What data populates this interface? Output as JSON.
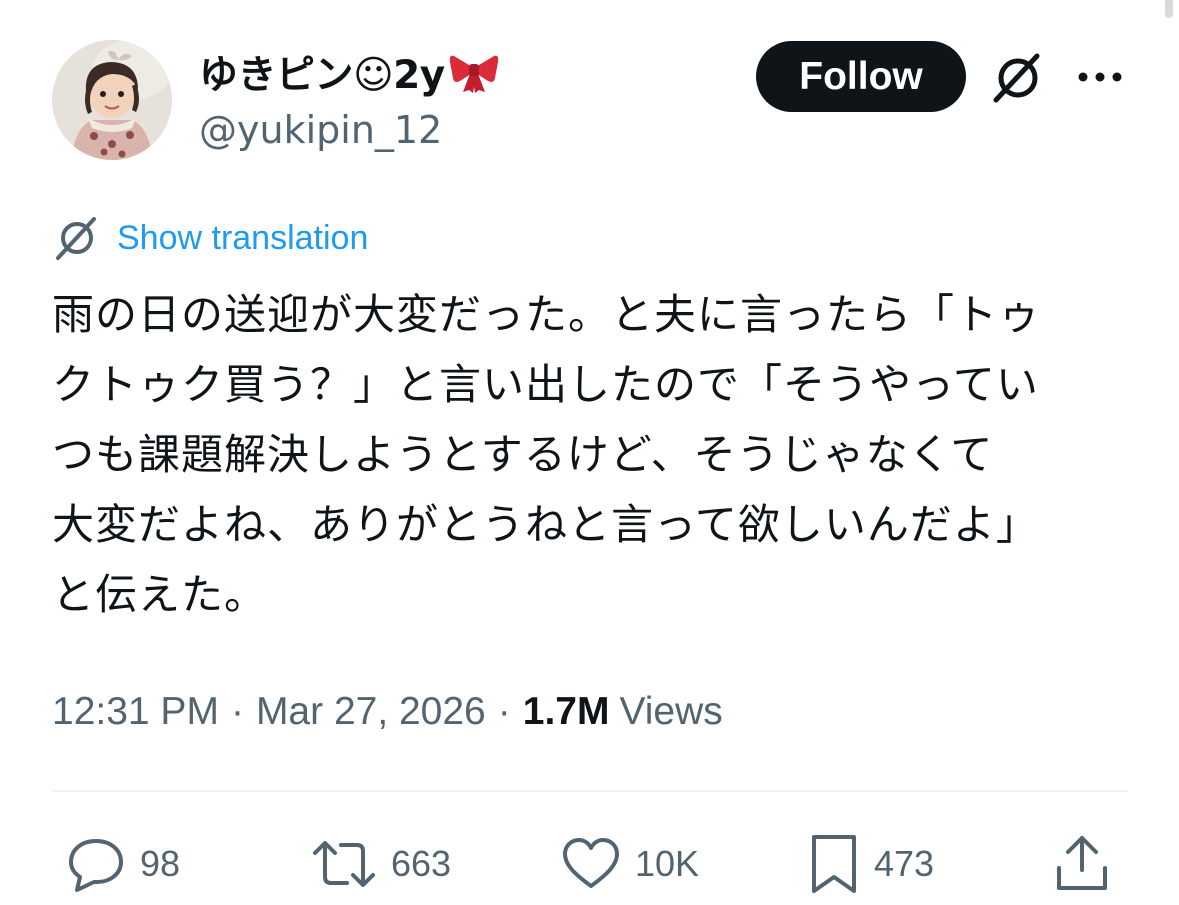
{
  "author": {
    "display_name": "ゆきピン☺2y",
    "handle": "@yukipin_12",
    "avatar_icon": "child-photo-avatar",
    "name_emoji_icon": "ribbon-bow-icon"
  },
  "header": {
    "follow_label": "Follow",
    "grok_icon": "grok-icon",
    "more_icon": "more-icon"
  },
  "translation": {
    "link_label": "Show translation",
    "link_color": "#1d9bf0"
  },
  "tweet": {
    "lines": [
      "雨の日の送迎が大変だった。と夫に言ったら「トゥ",
      "クトゥク買う？」と言い出したので「そうやってい",
      "つも課題解決しようとするけど、そうじゃなくて",
      "大変だよね、ありがとうねと言って欲しいんだよ」",
      "と伝えた。"
    ]
  },
  "meta": {
    "time": "12:31 PM",
    "separator": "·",
    "date": "Mar 27, 2026",
    "views_count": "1.7M",
    "views_label": "Views"
  },
  "actions": {
    "replies": "98",
    "reposts": "663",
    "likes": "10K",
    "bookmarks": "473"
  },
  "colors": {
    "text": "#0f1419",
    "muted": "#536471",
    "follow_bg": "#0f1419",
    "link": "#1d9bf0",
    "divider": "#eff3f4"
  }
}
